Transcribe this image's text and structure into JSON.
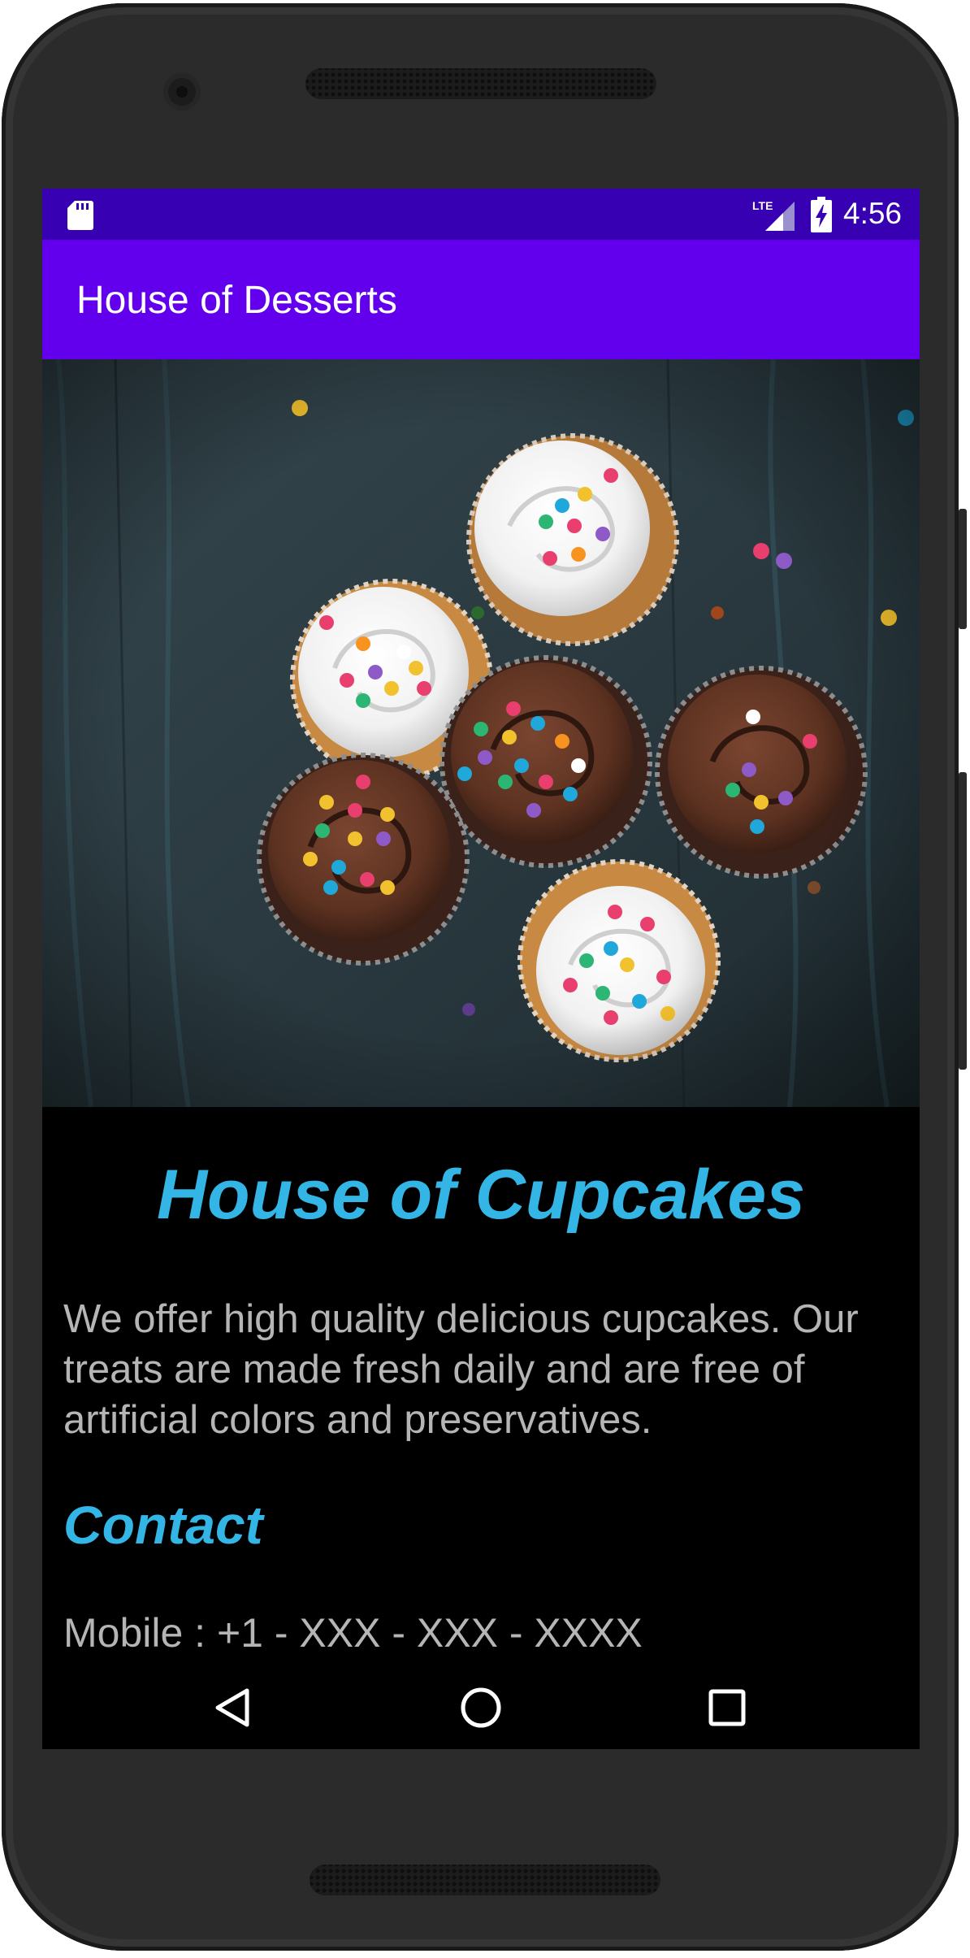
{
  "device": {
    "status_bar": {
      "time": "4:56",
      "network": "LTE",
      "icons": [
        "sd-card-icon",
        "lte-signal-icon",
        "battery-charging-icon"
      ],
      "color": "#3700b3"
    },
    "nav_bar": {
      "icons": [
        "back-icon",
        "home-icon",
        "recents-icon"
      ]
    }
  },
  "app_bar": {
    "title": "House of Desserts",
    "color": "#6200ee"
  },
  "hero_image": {
    "subject": "cupcakes-photo"
  },
  "content": {
    "headline": "House of Cupcakes",
    "about": "We offer  high quality delicious cupcakes. Our treats are made fresh daily and are free of artificial colors and preservatives.",
    "contact_heading": "Contact",
    "mobile": "Mobile : +1 - XXX - XXX - XXXX"
  },
  "colors": {
    "accent": "#33b5e5",
    "body_text": "#b5b5b5",
    "background": "#000000"
  }
}
